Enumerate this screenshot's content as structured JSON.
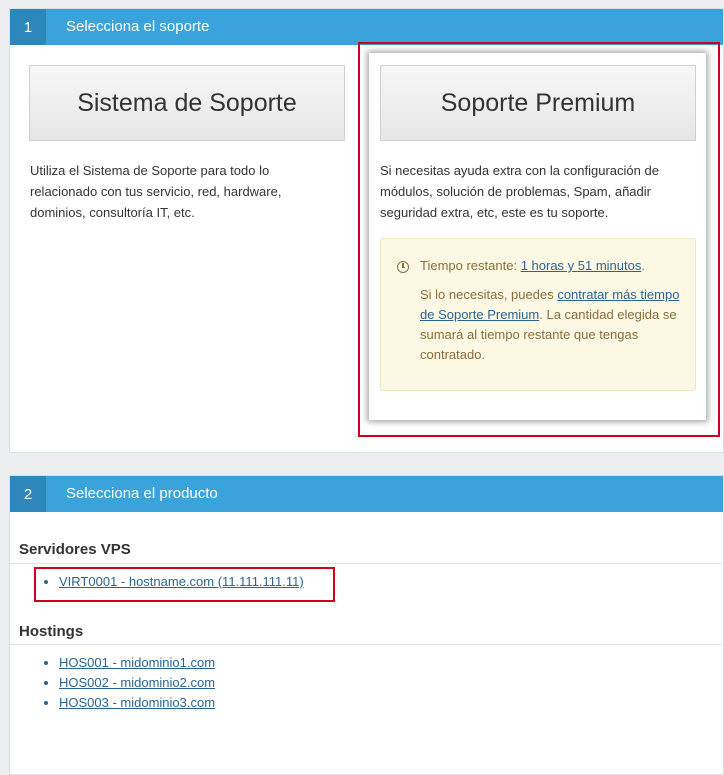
{
  "step1": {
    "number": "1",
    "title": "Selecciona el soporte",
    "support_system": {
      "button": "Sistema de Soporte",
      "description": "Utiliza el Sistema de Soporte para todo lo relacionado con tus servicio, red, hardware, dominios, consultoría IT, etc."
    },
    "premium": {
      "button": "Soporte Premium",
      "description": "Si necesitas ayuda extra con la configuración de módulos, solución de problemas, Spam, añadir seguridad extra, etc, este es tu soporte.",
      "time_label": "Tiempo restante:",
      "time_value": "1 horas y 51 minutos",
      "time_suffix": ".",
      "more_prefix": "Si lo necesitas, puedes",
      "more_link": "contratar más tiempo de Soporte Premium",
      "more_suffix": ". La cantidad elegida se sumará al tiempo restante que tengas contratado."
    }
  },
  "step2": {
    "number": "2",
    "title": "Selecciona el producto",
    "groups": [
      {
        "title": "Servidores VPS",
        "items": [
          "VIRT0001 - hostname.com (11.111.111.11)"
        ]
      },
      {
        "title": "Hostings",
        "items": [
          "HOS001 - midominio1.com",
          "HOS002 - midominio2.com",
          "HOS003 - midominio3.com"
        ]
      }
    ]
  },
  "colors": {
    "header_blue": "#3aa3dc",
    "step_blue": "#2e87bb",
    "highlight_red": "#d0021b",
    "alert_bg": "#fcf8e3",
    "link": "#2a6496"
  },
  "icons": {
    "time": "clock-icon"
  }
}
